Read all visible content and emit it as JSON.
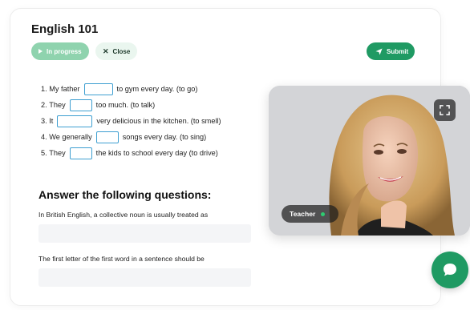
{
  "lesson": {
    "title": "English 101",
    "status_label": "In progress",
    "close_label": "Close",
    "submit_label": "Submit"
  },
  "exercise": {
    "rows": [
      {
        "num": "1.",
        "before": "My father",
        "after": "to gym every day. (to go)"
      },
      {
        "num": "2.",
        "before": "They",
        "after": "too much. (to talk)"
      },
      {
        "num": "3.",
        "before": "It",
        "after": "very delicious in the kitchen. (to smell)"
      },
      {
        "num": "4.",
        "before": "We generally",
        "after": "songs every day. (to sing)"
      },
      {
        "num": "5.",
        "before": "They",
        "after": "the kids to school every day (to drive)"
      }
    ]
  },
  "questions": {
    "heading": "Answer the following questions:",
    "items": [
      {
        "text": "In British English, a collective noun is usually treated as",
        "value": ""
      },
      {
        "text": "The first letter of the first word in a sentence should be",
        "value": ""
      }
    ]
  },
  "video": {
    "label": "Teacher",
    "status_color": "#2ecc71"
  },
  "icons": {
    "status": "play-icon",
    "close": "close-icon",
    "submit": "send-icon",
    "expand": "fullscreen-icon",
    "chat": "chat-bubble-icon"
  },
  "colors": {
    "accent": "#1f9a63",
    "progress_badge": "#8fd3ae",
    "blank_border": "#3e9fd1"
  }
}
